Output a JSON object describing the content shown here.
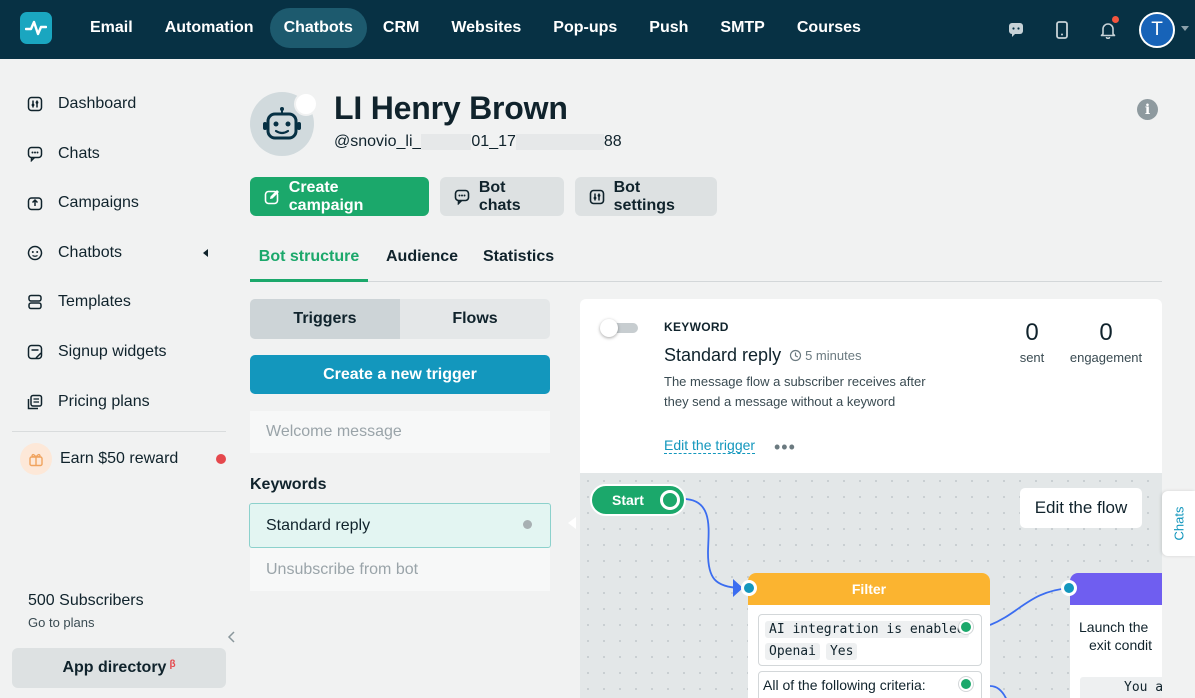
{
  "nav": {
    "items": [
      {
        "label": "Email"
      },
      {
        "label": "Automation"
      },
      {
        "label": "Chatbots",
        "active": true
      },
      {
        "label": "CRM"
      },
      {
        "label": "Websites"
      },
      {
        "label": "Pop-ups"
      },
      {
        "label": "Push"
      },
      {
        "label": "SMTP"
      },
      {
        "label": "Courses"
      }
    ],
    "icons": [
      "chat-support-icon",
      "mobile-icon",
      "bell-icon"
    ],
    "avatar_initial": "T"
  },
  "sidebar": {
    "items": [
      {
        "label": "Dashboard",
        "icon": "dashboard-icon"
      },
      {
        "label": "Chats",
        "icon": "chat-icon"
      },
      {
        "label": "Campaigns",
        "icon": "campaign-icon"
      },
      {
        "label": "Chatbots",
        "icon": "bot-icon"
      },
      {
        "label": "Templates",
        "icon": "templates-icon"
      },
      {
        "label": "Signup widgets",
        "icon": "widget-icon"
      },
      {
        "label": "Pricing plans",
        "icon": "pricing-icon"
      }
    ],
    "earn": "Earn $50 reward",
    "subscribers": "500 Subscribers",
    "go_to_plans": "Go to plans",
    "app_directory": "App directory",
    "beta": "β"
  },
  "bot": {
    "name": "LI Henry Brown",
    "handle_part1": "@snovio_li_",
    "handle_part2": "01_17",
    "handle_part3": "88"
  },
  "actions": {
    "create_campaign": "Create campaign",
    "bot_chats": "Bot chats",
    "bot_settings": "Bot settings"
  },
  "tabs": [
    {
      "label": "Bot structure",
      "active": true
    },
    {
      "label": "Audience"
    },
    {
      "label": "Statistics"
    }
  ],
  "left": {
    "seg_triggers": "Triggers",
    "seg_flows": "Flows",
    "create_trigger": "Create a new trigger",
    "welcome": "Welcome message",
    "keywords_label": "Keywords",
    "standard_reply": "Standard reply",
    "unsubscribe": "Unsubscribe from bot"
  },
  "trigger": {
    "type": "KEYWORD",
    "title": "Standard reply",
    "time": "5 minutes",
    "description": "The message flow a subscriber receives after they send a message without a keyword",
    "edit": "Edit the trigger",
    "more": "•••",
    "sent_value": "0",
    "sent_label": "sent",
    "engagement_value": "0",
    "engagement_label": "engagement"
  },
  "flow": {
    "start": "Start",
    "edit_flow": "Edit the flow",
    "filter_title": "Filter",
    "cond1_a": "AI integration is enabled",
    "cond1_b": "Openai",
    "cond1_c": "Yes",
    "cond2": "All of the following criteria:",
    "purple_text1": "Launch the",
    "purple_text2": "exit condit",
    "purple_mono": "You a"
  },
  "chats_tab": "Chats"
}
